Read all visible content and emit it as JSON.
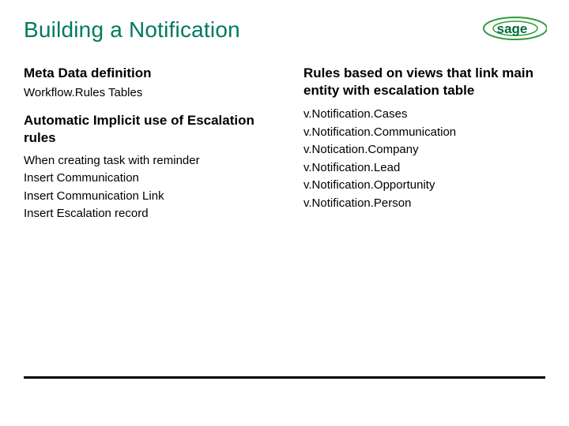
{
  "title": "Building a Notification",
  "logo": {
    "name": "sage"
  },
  "left": {
    "h1": "Meta Data definition",
    "sub1": "Workflow.Rules Tables",
    "h2": "Automatic Implicit use of Escalation rules",
    "items": [
      "When creating task with reminder",
      "Insert Communication",
      "Insert Communication Link",
      "Insert Escalation record"
    ]
  },
  "right": {
    "h1": "Rules based on views that link main entity with escalation table",
    "items": [
      "v.Notification.Cases",
      "v.Notification.Communication",
      "v.Notication.Company",
      "v.Notification.Lead",
      "v.Notification.Opportunity",
      "v.Notification.Person"
    ]
  }
}
